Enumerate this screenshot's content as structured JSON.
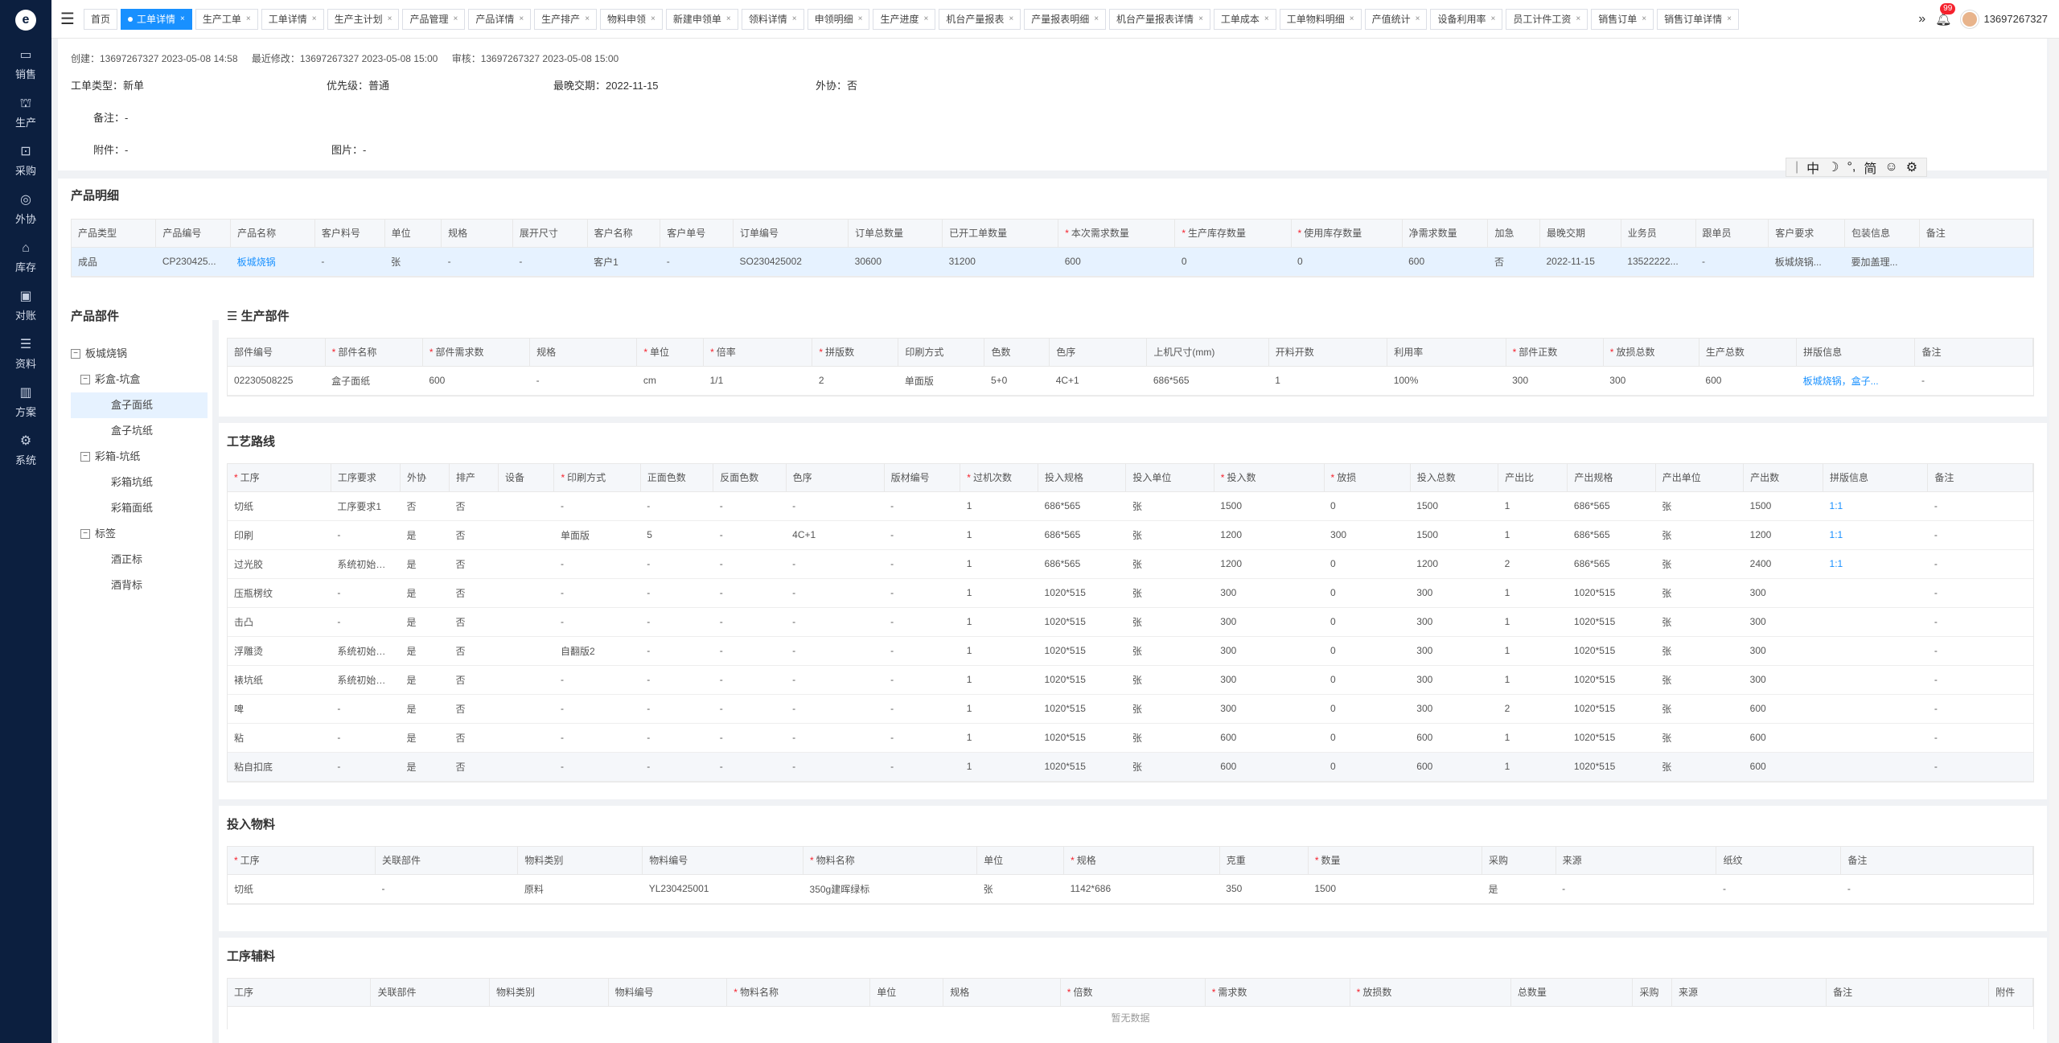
{
  "sidebar": {
    "logo": "e",
    "items": [
      {
        "icon": "cart-icon",
        "glyph": "▭",
        "label": "销售"
      },
      {
        "icon": "factory-icon",
        "glyph": "⛫",
        "label": "生产"
      },
      {
        "icon": "purchase-icon",
        "glyph": "⊡",
        "label": "采购"
      },
      {
        "icon": "outsource-icon",
        "glyph": "◎",
        "label": "外协"
      },
      {
        "icon": "warehouse-icon",
        "glyph": "⌂",
        "label": "库存"
      },
      {
        "icon": "reconcile-icon",
        "glyph": "▣",
        "label": "对账"
      },
      {
        "icon": "data-icon",
        "glyph": "☰",
        "label": "资料"
      },
      {
        "icon": "plan-icon",
        "glyph": "▥",
        "label": "方案"
      },
      {
        "icon": "system-icon",
        "glyph": "⚙",
        "label": "系统"
      }
    ]
  },
  "tabs": [
    {
      "label": "首页",
      "closable": false,
      "active": false
    },
    {
      "label": "工单详情",
      "closable": true,
      "active": true
    },
    {
      "label": "生产工单",
      "closable": true,
      "active": false
    },
    {
      "label": "工单详情",
      "closable": true,
      "active": false
    },
    {
      "label": "生产主计划",
      "closable": true,
      "active": false
    },
    {
      "label": "产品管理",
      "closable": true,
      "active": false
    },
    {
      "label": "产品详情",
      "closable": true,
      "active": false
    },
    {
      "label": "生产排产",
      "closable": true,
      "active": false
    },
    {
      "label": "物料申领",
      "closable": true,
      "active": false
    },
    {
      "label": "新建申领单",
      "closable": true,
      "active": false
    },
    {
      "label": "领料详情",
      "closable": true,
      "active": false
    },
    {
      "label": "申领明细",
      "closable": true,
      "active": false
    },
    {
      "label": "生产进度",
      "closable": true,
      "active": false
    },
    {
      "label": "机台产量报表",
      "closable": true,
      "active": false
    },
    {
      "label": "产量报表明细",
      "closable": true,
      "active": false
    },
    {
      "label": "机台产量报表详情",
      "closable": true,
      "active": false
    },
    {
      "label": "工单成本",
      "closable": true,
      "active": false
    },
    {
      "label": "工单物料明细",
      "closable": true,
      "active": false
    },
    {
      "label": "产值统计",
      "closable": true,
      "active": false
    },
    {
      "label": "设备利用率",
      "closable": true,
      "active": false
    },
    {
      "label": "员工计件工资",
      "closable": true,
      "active": false
    },
    {
      "label": "销售订单",
      "closable": true,
      "active": false
    },
    {
      "label": "销售订单详情",
      "closable": true,
      "active": false
    }
  ],
  "header": {
    "notifications": "99",
    "user": "13697267327"
  },
  "meta": {
    "created": "创建：13697267327 2023-05-08 14:58",
    "modified": "最近修改：13697267327 2023-05-08 15:00",
    "audited": "审核：13697267327 2023-05-08 15:00"
  },
  "info": {
    "type": "工单类型：新单",
    "priority": "优先级：普通",
    "deadline": "最晚交期：2022-11-15",
    "outsource": "外协：否",
    "remark": "备注：-",
    "attachment": "附件：-",
    "image": "图片：-"
  },
  "ime": {
    "items": [
      "中",
      "☽",
      "°,",
      "简",
      "☺",
      "⚙"
    ]
  },
  "product_detail": {
    "title": "产品明细",
    "columns": [
      {
        "label": "产品类型",
        "req": false
      },
      {
        "label": "产品编号",
        "req": false
      },
      {
        "label": "产品名称",
        "req": false
      },
      {
        "label": "客户料号",
        "req": false
      },
      {
        "label": "单位",
        "req": false
      },
      {
        "label": "规格",
        "req": false
      },
      {
        "label": "展开尺寸",
        "req": false
      },
      {
        "label": "客户名称",
        "req": false
      },
      {
        "label": "客户单号",
        "req": false
      },
      {
        "label": "订单编号",
        "req": false
      },
      {
        "label": "订单总数量",
        "req": false
      },
      {
        "label": "已开工单数量",
        "req": false
      },
      {
        "label": "本次需求数量",
        "req": true
      },
      {
        "label": "生产库存数量",
        "req": true
      },
      {
        "label": "使用库存数量",
        "req": true
      },
      {
        "label": "净需求数量",
        "req": false
      },
      {
        "label": "加急",
        "req": false
      },
      {
        "label": "最晚交期",
        "req": false
      },
      {
        "label": "业务员",
        "req": false
      },
      {
        "label": "跟单员",
        "req": false
      },
      {
        "label": "客户要求",
        "req": false
      },
      {
        "label": "包装信息",
        "req": false
      },
      {
        "label": "备注",
        "req": false
      }
    ],
    "widths": [
      104,
      92,
      104,
      86,
      70,
      88,
      92,
      90,
      90,
      142,
      116,
      143,
      144,
      143,
      137,
      106,
      64,
      100,
      92,
      90,
      94,
      92,
      140
    ],
    "rows": [
      [
        "成品",
        "CP230425...",
        "板城烧锅",
        "-",
        "张",
        "-",
        "-",
        "客户1",
        "-",
        "SO230425002",
        "30600",
        "31200",
        "600",
        "0",
        "0",
        "600",
        "否",
        "2022-11-15",
        "13522222...",
        "-",
        "板城烧锅...",
        "要加盖理...",
        ""
      ]
    ],
    "link_cols": [
      2
    ]
  },
  "parts": {
    "title": "产品部件",
    "tree": [
      {
        "label": "板城烧锅",
        "level": 0,
        "expander": "−",
        "selected": false
      },
      {
        "label": "彩盒-坑盒",
        "level": 1,
        "expander": "−",
        "selected": false
      },
      {
        "label": "盒子面纸",
        "level": 2,
        "expander": "",
        "selected": true
      },
      {
        "label": "盒子坑纸",
        "level": 2,
        "expander": "",
        "selected": false
      },
      {
        "label": "彩箱-坑纸",
        "level": 1,
        "expander": "−",
        "selected": false
      },
      {
        "label": "彩箱坑纸",
        "level": 2,
        "expander": "",
        "selected": false
      },
      {
        "label": "彩箱面纸",
        "level": 2,
        "expander": "",
        "selected": false
      },
      {
        "label": "标签",
        "level": 1,
        "expander": "−",
        "selected": false
      },
      {
        "label": "酒正标",
        "level": 2,
        "expander": "",
        "selected": false
      },
      {
        "label": "酒背标",
        "level": 2,
        "expander": "",
        "selected": false
      }
    ]
  },
  "production_part": {
    "title": "生产部件",
    "columns": [
      {
        "label": "部件编号",
        "req": false
      },
      {
        "label": "部件名称",
        "req": true
      },
      {
        "label": "部件需求数",
        "req": true
      },
      {
        "label": "规格",
        "req": false
      },
      {
        "label": "单位",
        "req": true
      },
      {
        "label": "倍率",
        "req": true
      },
      {
        "label": "拼版数",
        "req": true
      },
      {
        "label": "印刷方式",
        "req": false
      },
      {
        "label": "色数",
        "req": false
      },
      {
        "label": "色序",
        "req": false
      },
      {
        "label": "上机尺寸(mm)",
        "req": false
      },
      {
        "label": "开料开数",
        "req": false
      },
      {
        "label": "利用率",
        "req": false
      },
      {
        "label": "部件正数",
        "req": true
      },
      {
        "label": "放损总数",
        "req": true
      },
      {
        "label": "生产总数",
        "req": false
      },
      {
        "label": "拼版信息",
        "req": false
      },
      {
        "label": "备注",
        "req": false
      }
    ],
    "widths": [
      120,
      120,
      132,
      132,
      82,
      134,
      106,
      106,
      80,
      120,
      150,
      146,
      146,
      120,
      118,
      120,
      146,
      145
    ],
    "rows": [
      [
        "02230508225",
        "盒子面纸",
        "600",
        "-",
        "cm",
        "1/1",
        "2",
        "单面版",
        "5+0",
        "4C+1",
        "686*565",
        "1",
        "100%",
        "300",
        "300",
        "600",
        "板城烧锅，盒子...",
        "-"
      ]
    ],
    "link_cols": [
      16
    ]
  },
  "route": {
    "title": "工艺路线",
    "columns": [
      {
        "label": "工序",
        "req": true
      },
      {
        "label": "工序要求",
        "req": false
      },
      {
        "label": "外协",
        "req": false
      },
      {
        "label": "排产",
        "req": false
      },
      {
        "label": "设备",
        "req": false
      },
      {
        "label": "印刷方式",
        "req": true
      },
      {
        "label": "正面色数",
        "req": false
      },
      {
        "label": "反面色数",
        "req": false
      },
      {
        "label": "色序",
        "req": false
      },
      {
        "label": "版材编号",
        "req": false
      },
      {
        "label": "过机次数",
        "req": true
      },
      {
        "label": "投入规格",
        "req": false
      },
      {
        "label": "投入单位",
        "req": false
      },
      {
        "label": "投入数",
        "req": true
      },
      {
        "label": "放损",
        "req": true
      },
      {
        "label": "投入总数",
        "req": false
      },
      {
        "label": "产出比",
        "req": false
      },
      {
        "label": "产出规格",
        "req": false
      },
      {
        "label": "产出单位",
        "req": false
      },
      {
        "label": "产出数",
        "req": false
      },
      {
        "label": "拼版信息",
        "req": false
      },
      {
        "label": "备注",
        "req": false
      }
    ],
    "widths": [
      122,
      82,
      58,
      58,
      66,
      102,
      86,
      86,
      116,
      90,
      92,
      104,
      104,
      130,
      102,
      104,
      82,
      104,
      104,
      94,
      124,
      124
    ],
    "rows": [
      [
        "切纸",
        "工序要求1",
        "否",
        "否",
        "",
        "-",
        "-",
        "-",
        "-",
        "-",
        "1",
        "686*565",
        "张",
        "1500",
        "0",
        "1500",
        "1",
        "686*565",
        "张",
        "1500",
        "1:1",
        "-"
      ],
      [
        "印刷",
        "-",
        "是",
        "否",
        "",
        "单面版",
        "5",
        "-",
        "4C+1",
        "-",
        "1",
        "686*565",
        "张",
        "1200",
        "300",
        "1500",
        "1",
        "686*565",
        "张",
        "1200",
        "1:1",
        "-"
      ],
      [
        "过光胶",
        "系统初始化生成",
        "是",
        "否",
        "",
        "-",
        "-",
        "-",
        "-",
        "-",
        "1",
        "686*565",
        "张",
        "1200",
        "0",
        "1200",
        "2",
        "686*565",
        "张",
        "2400",
        "1:1",
        "-"
      ],
      [
        "压瓶楞纹",
        "-",
        "是",
        "否",
        "",
        "-",
        "-",
        "-",
        "-",
        "-",
        "1",
        "1020*515",
        "张",
        "300",
        "0",
        "300",
        "1",
        "1020*515",
        "张",
        "300",
        "",
        "-"
      ],
      [
        "击凸",
        "-",
        "是",
        "否",
        "",
        "-",
        "-",
        "-",
        "-",
        "-",
        "1",
        "1020*515",
        "张",
        "300",
        "0",
        "300",
        "1",
        "1020*515",
        "张",
        "300",
        "",
        "-"
      ],
      [
        "浮雕烫",
        "系统初始化生成",
        "是",
        "否",
        "",
        "自翻版2",
        "-",
        "-",
        "-",
        "-",
        "1",
        "1020*515",
        "张",
        "300",
        "0",
        "300",
        "1",
        "1020*515",
        "张",
        "300",
        "",
        "-"
      ],
      [
        "裱坑纸",
        "系统初始化生成",
        "是",
        "否",
        "",
        "-",
        "-",
        "-",
        "-",
        "-",
        "1",
        "1020*515",
        "张",
        "300",
        "0",
        "300",
        "1",
        "1020*515",
        "张",
        "300",
        "",
        "-"
      ],
      [
        "啤",
        "-",
        "是",
        "否",
        "",
        "-",
        "-",
        "-",
        "-",
        "-",
        "1",
        "1020*515",
        "张",
        "300",
        "0",
        "300",
        "2",
        "1020*515",
        "张",
        "600",
        "",
        "-"
      ],
      [
        "粘",
        "-",
        "是",
        "否",
        "",
        "-",
        "-",
        "-",
        "-",
        "-",
        "1",
        "1020*515",
        "张",
        "600",
        "0",
        "600",
        "1",
        "1020*515",
        "张",
        "600",
        "",
        "-"
      ],
      [
        "粘自扣底",
        "-",
        "是",
        "否",
        "",
        "-",
        "-",
        "-",
        "-",
        "-",
        "1",
        "1020*515",
        "张",
        "600",
        "0",
        "600",
        "1",
        "1020*515",
        "张",
        "600",
        "",
        "-"
      ]
    ],
    "link_cols": [
      20
    ]
  },
  "materials": {
    "title": "投入物料",
    "columns": [
      {
        "label": "工序",
        "req": true
      },
      {
        "label": "关联部件",
        "req": false
      },
      {
        "label": "物料类别",
        "req": false
      },
      {
        "label": "物料编号",
        "req": false
      },
      {
        "label": "物料名称",
        "req": true
      },
      {
        "label": "单位",
        "req": false
      },
      {
        "label": "规格",
        "req": true
      },
      {
        "label": "克重",
        "req": false
      },
      {
        "label": "数量",
        "req": true
      },
      {
        "label": "采购",
        "req": false
      },
      {
        "label": "来源",
        "req": false
      },
      {
        "label": "纸纹",
        "req": false
      },
      {
        "label": "备注",
        "req": false
      }
    ],
    "widths": [
      180,
      174,
      152,
      196,
      212,
      106,
      190,
      108,
      212,
      90,
      196,
      152,
      234
    ],
    "rows": [
      [
        "切纸",
        "-",
        "原料",
        "YL230425001",
        "350g建晖绿标",
        "张",
        "1142*686",
        "350",
        "1500",
        "是",
        "-",
        "-",
        "-"
      ]
    ],
    "link_cols": []
  },
  "aux": {
    "title": "工序辅料",
    "columns": [
      {
        "label": "工序",
        "req": false
      },
      {
        "label": "关联部件",
        "req": false
      },
      {
        "label": "物料类别",
        "req": false
      },
      {
        "label": "物料编号",
        "req": false
      },
      {
        "label": "物料名称",
        "req": true
      },
      {
        "label": "单位",
        "req": false
      },
      {
        "label": "规格",
        "req": false
      },
      {
        "label": "倍数",
        "req": true
      },
      {
        "label": "需求数",
        "req": true
      },
      {
        "label": "放损数",
        "req": true
      },
      {
        "label": "总数量",
        "req": false
      },
      {
        "label": "采购",
        "req": false
      },
      {
        "label": "来源",
        "req": false
      },
      {
        "label": "备注",
        "req": false
      },
      {
        "label": "附件",
        "req": false
      }
    ],
    "widths": [
      176,
      146,
      146,
      146,
      176,
      90,
      144,
      178,
      178,
      198,
      150,
      48,
      190,
      200,
      54
    ],
    "empty": "暂无数据"
  }
}
